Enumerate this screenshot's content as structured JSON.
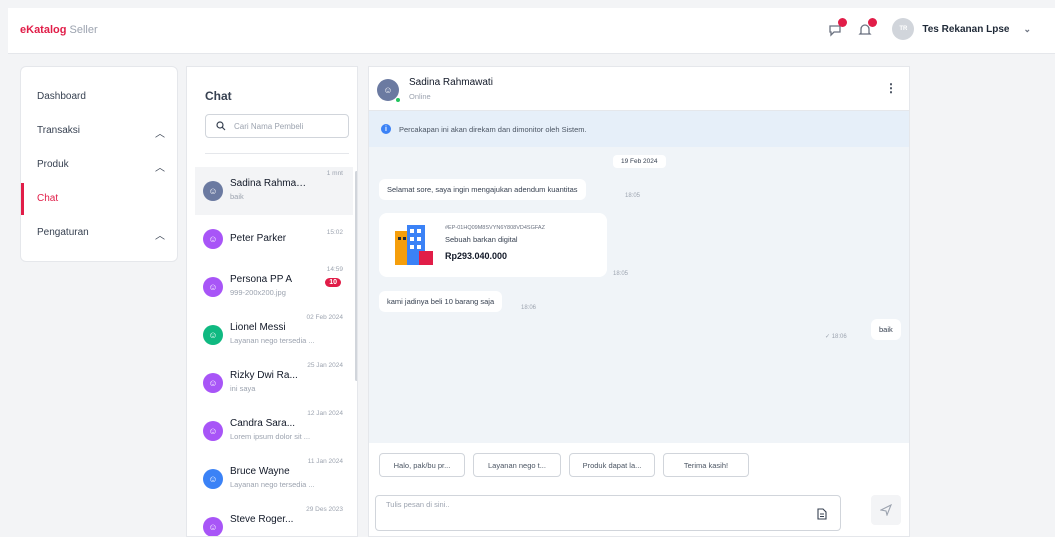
{
  "app": {
    "logo_e": "e",
    "logo_main": "Katalog",
    "logo_sub": "Seller",
    "user_name": "Tes Rekanan Lpse",
    "user_initials": "TR"
  },
  "colors": {
    "accent": "#e11d48",
    "purple": "#a855f7",
    "teal": "#10b981",
    "blue": "#3b82f6",
    "slate": "#6b7aa1"
  },
  "sidebar": {
    "items": [
      {
        "label": "Dashboard",
        "chevron": ""
      },
      {
        "label": "Transaksi",
        "chevron": "^"
      },
      {
        "label": "Produk",
        "chevron": "^"
      },
      {
        "label": "Chat",
        "chevron": ""
      },
      {
        "label": "Pengaturan",
        "chevron": "^"
      }
    ]
  },
  "chatlist": {
    "title": "Chat",
    "search_placeholder": "Cari Nama Pembeli",
    "contacts": [
      {
        "name": "Sadina Rahmawati",
        "preview": "baik",
        "time": "1 mnt",
        "badge": ""
      },
      {
        "name": "Peter Parker",
        "preview": "",
        "time": "15:02",
        "badge": ""
      },
      {
        "name": "Persona PP A",
        "preview": "999-200x200.jpg",
        "time": "14:59",
        "badge": "10"
      },
      {
        "name": "Lionel Messi",
        "preview": "Layanan nego tersedia ...",
        "time": "02 Feb 2024",
        "badge": ""
      },
      {
        "name": "Rizky Dwi Ra...",
        "preview": "ini saya",
        "time": "25 Jan 2024",
        "badge": ""
      },
      {
        "name": "Candra Sara...",
        "preview": "Lorem ipsum dolor sit ...",
        "time": "12 Jan 2024",
        "badge": ""
      },
      {
        "name": "Bruce Wayne",
        "preview": "Layanan nego tersedia ...",
        "time": "11 Jan 2024",
        "badge": ""
      },
      {
        "name": "Steve Roger...",
        "preview": "",
        "time": "29 Des 2023",
        "badge": ""
      }
    ]
  },
  "conversation": {
    "name": "Sadina Rahmawati",
    "status": "Online",
    "notice": "Percakapan ini akan direkam dan dimonitor oleh Sistem.",
    "date": "19 Feb 2024",
    "msg1": {
      "text": "Selamat sore, saya ingin mengajukan adendum kuantitas",
      "time": "18:05"
    },
    "product": {
      "sku": "#EP-01HQ09M8SVYN6Y808VD4SGFAZ",
      "name": "Sebuah barkan digital",
      "price": "Rp293.040.000",
      "time": "18:05"
    },
    "msg2": {
      "text": "kami jadinya beli 10 barang saja",
      "time": "18:06"
    },
    "msg3": {
      "text": "baik",
      "time": "18:06",
      "check": "✓"
    },
    "quick_replies": [
      "Halo, pak/bu pr...",
      "Layanan nego t...",
      "Produk dapat la...",
      "Terima kasih!"
    ],
    "input_placeholder": "Tulis pesan di sini..",
    "more": "⋮"
  }
}
